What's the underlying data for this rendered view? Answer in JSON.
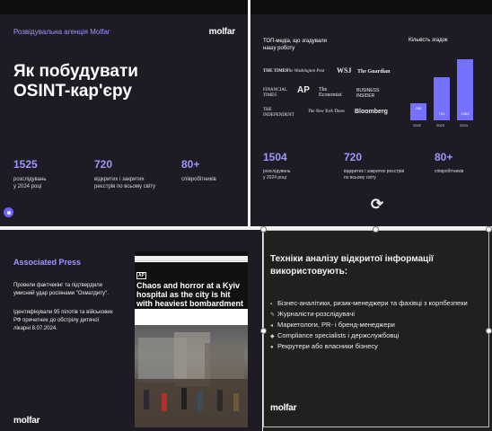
{
  "slide1": {
    "agency": "Розвідувальна агенція Molfar",
    "logo": "molfar",
    "title_line1": "Як побудувати",
    "title_line2": "OSINT-кар'єру",
    "stats": [
      {
        "value": "1525",
        "label_line1": "розслідувань",
        "label_line2": "у 2024 році"
      },
      {
        "value": "720",
        "label_line1": "відкритих і закритих",
        "label_line2": "реєстрів по всьому світу"
      },
      {
        "value": "80+",
        "label_line1": "співробітників",
        "label_line2": ""
      }
    ]
  },
  "slide2": {
    "media_title_line1": "ТОП-медіа, що згадували",
    "media_title_line2": "нашу роботу",
    "mentions_title": "Кількість згадок",
    "media": [
      "THE TIMES",
      "The Washington Post",
      "WSJ",
      "The Guardian",
      "FINANCIAL TIMES",
      "AP",
      "The Economist",
      "BUSINESS INSIDER",
      "THE INDEPENDENT",
      "The New York Times",
      "Bloomberg"
    ],
    "stats": [
      {
        "value": "1504",
        "label_line1": "розслідувань",
        "label_line2": "у 2024 році"
      },
      {
        "value": "720",
        "label_line1": "відкритих і закритих реєстрів",
        "label_line2": "по всьому світу"
      },
      {
        "value": "80+",
        "label_line1": "співробітників",
        "label_line2": ""
      }
    ],
    "chart_data": {
      "type": "bar",
      "categories": [
        "2022",
        "2023",
        "2024"
      ],
      "values": [
        298,
        741,
        1063
      ],
      "title": "Кількість згадок",
      "xlabel": "",
      "ylabel": "",
      "color": "#7471ff"
    }
  },
  "slide3": {
    "title": "Associated Press",
    "para1_line1": "Провели фактчекінг та підтвердили",
    "para1_line2": "умисний удар росіянами \"Охматдиту\".",
    "para2_line1": "Ідентифікували 95 пілотів та військових",
    "para2_line2": "РФ  причетних до обстрілу дитячої",
    "para2_line3": "лікарні 8.07.2024.",
    "logo": "molfar",
    "news_outlet": "AP",
    "news_headline": "Chaos and horror at a Kyiv hospital as the city is hit with heaviest bombardment in months"
  },
  "slide4": {
    "title_line1": "Техніки аналізу відкритої інформації",
    "title_line2": "використовують:",
    "bullets": [
      "Бізнес-аналітики, ризик-менеджери та фахівці з корпбезпеки",
      "Журналісти-розслідувачі",
      "Маркетологи, PR- і бренд-менеджери",
      "Compliance specialists і держслужбовці",
      "Рекрутери або власники бізнесу"
    ],
    "logo": "molfar"
  }
}
